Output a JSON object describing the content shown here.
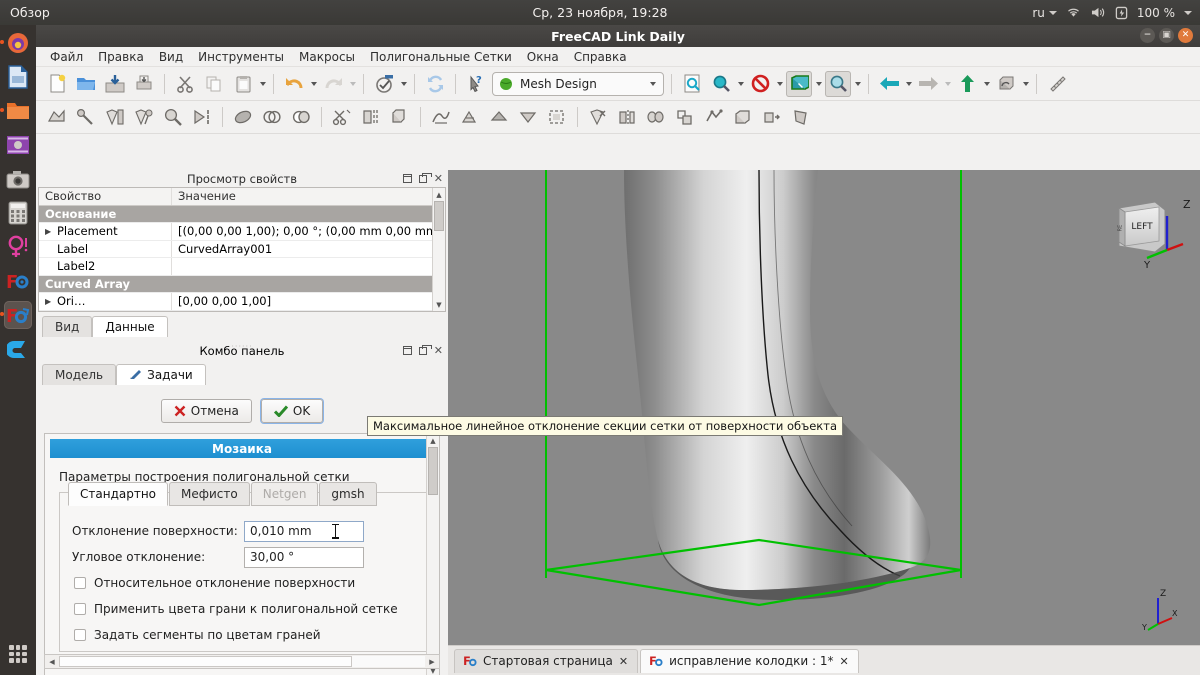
{
  "system_bar": {
    "activities": "Обзор",
    "clock": "Ср, 23 ноября, 19:28",
    "keyboard_layout": "ru",
    "battery": "100 %",
    "icons": [
      "wifi-icon",
      "volume-icon",
      "battery-icon"
    ]
  },
  "launcher": {
    "items": [
      {
        "name": "firefox",
        "label": "F",
        "color": "#e8683a",
        "running": true,
        "active": false
      },
      {
        "name": "libreoffice-writer",
        "label": "W",
        "color": "#2a6099",
        "running": false,
        "active": false
      },
      {
        "name": "files",
        "label": "▭",
        "color": "#e8702a",
        "running": true,
        "active": false
      },
      {
        "name": "video-editor",
        "label": "▶",
        "color": "#8e44ad",
        "running": false,
        "active": false
      },
      {
        "name": "camera",
        "label": "◎",
        "color": "#b9b6b2",
        "running": false,
        "active": false
      },
      {
        "name": "calculator",
        "label": "≡",
        "color": "#cfcac6",
        "running": false,
        "active": false
      },
      {
        "name": "magnifier-tool",
        "label": "Q!",
        "color": "#e040a0",
        "running": false,
        "active": false
      },
      {
        "name": "freecad",
        "label": "F",
        "color": "#cc2222",
        "running": false,
        "active": false
      },
      {
        "name": "freecad-link-daily",
        "label": "F",
        "color": "#cc2222",
        "running": true,
        "active": true
      },
      {
        "name": "clementine",
        "label": "C",
        "color": "#2aa8e8",
        "running": false,
        "active": false
      }
    ],
    "show_applications_label": "show-applications"
  },
  "window": {
    "title": "FreeCAD Link Daily",
    "controls": [
      "minimize",
      "maximize",
      "close"
    ]
  },
  "menubar": {
    "items": [
      {
        "label": "Файл",
        "mnemonic": "Ф"
      },
      {
        "label": "Правка",
        "mnemonic": "П"
      },
      {
        "label": "Вид",
        "mnemonic": "В"
      },
      {
        "label": "Инструменты",
        "mnemonic": "И"
      },
      {
        "label": "Макросы",
        "mnemonic": "М"
      },
      {
        "label": "Полигональные Сетки",
        "mnemonic": "П"
      },
      {
        "label": "Окна",
        "mnemonic": ""
      },
      {
        "label": "Справка",
        "mnemonic": "С"
      }
    ]
  },
  "toolbar": {
    "workbench_selector": {
      "value": "Mesh Design",
      "icon": "mesh-workbench-icon"
    },
    "file_group": [
      "new-document-icon",
      "open-document-icon",
      "save-document-icon",
      "print-icon"
    ],
    "edit_group": [
      "cut-icon",
      "copy-icon",
      "paste-icon",
      "undo-icon",
      "redo-icon"
    ],
    "misc_group": [
      "refresh-icon",
      "whats-this-icon",
      "std-view-fit-icon"
    ],
    "view_group": [
      "fit-all-icon",
      "zoom-icon",
      "draw-style-icon",
      "axonometric-icon",
      "zoom-box-icon",
      "back-arrow-icon",
      "forward-arrow-icon",
      "up-arrow-icon",
      "view-rotate-icon",
      "measure-icon"
    ],
    "mesh_group": [
      "mesh-from-shape-icon",
      "mesh-analyze-icon",
      "mesh-evaluate-icon",
      "mesh-repair-icon",
      "mesh-inspect-icon",
      "mesh-boundary-icon",
      "mesh-solid-icon",
      "mesh-union-icon",
      "mesh-intersect-icon",
      "mesh-cut-icon",
      "mesh-trim-icon",
      "mesh-section-icon",
      "mesh-smooth-icon",
      "mesh-decimate-icon",
      "mesh-flip-icon",
      "mesh-harmonize-icon",
      "mesh-fill-hole-icon",
      "mesh-remove-components-icon",
      "mesh-split-icon",
      "mesh-merge-icon",
      "mesh-scale-icon",
      "mesh-segment-icon",
      "mesh-build-icon",
      "mesh-export-icon",
      "mesh-polygon-icon"
    ]
  },
  "property_panel": {
    "title": "Просмотр свойств",
    "columns": [
      "Свойство",
      "Значение"
    ],
    "rows": [
      {
        "type": "group",
        "name": "Основание"
      },
      {
        "type": "item",
        "expandable": true,
        "name": "Placement",
        "value": "[(0,00 0,00 1,00); 0,00 °; (0,00 mm  0,00 mm…"
      },
      {
        "type": "item",
        "expandable": false,
        "name": "Label",
        "value": "CurvedArray001"
      },
      {
        "type": "item",
        "expandable": false,
        "name": "Label2",
        "value": ""
      },
      {
        "type": "group",
        "name": "Curved Array"
      },
      {
        "type": "item",
        "expandable": true,
        "name": "Ori…",
        "value": "[0,00 0,00 1,00]"
      }
    ],
    "tabs": [
      {
        "label": "Вид",
        "selected": false
      },
      {
        "label": "Данные",
        "selected": true
      }
    ],
    "header_buttons": [
      "restore-icon",
      "float-icon",
      "close-icon"
    ]
  },
  "combo_panel": {
    "title": "Комбо панель",
    "header_buttons": [
      "restore-icon",
      "float-icon",
      "close-icon"
    ],
    "tabs": [
      {
        "label": "Модель",
        "selected": false,
        "icon": ""
      },
      {
        "label": "Задачи",
        "selected": true,
        "icon": "tasks-icon"
      }
    ]
  },
  "task_dialog": {
    "cancel_button": {
      "label": "Отмена",
      "mnemonic": "м",
      "icon": "cancel-x-icon"
    },
    "ok_button": {
      "label": "OK",
      "mnemonic": "O",
      "icon": "ok-check-icon"
    },
    "section_title": "Мозаика",
    "subtitle": "Параметры построения полигональной сетки",
    "mesher_tabs": [
      {
        "label": "Стандартно",
        "selected": true,
        "enabled": true
      },
      {
        "label": "Мефисто",
        "selected": false,
        "enabled": true
      },
      {
        "label": "Netgen",
        "selected": false,
        "enabled": false
      },
      {
        "label": "gmsh",
        "selected": false,
        "enabled": true
      }
    ],
    "fields": [
      {
        "name": "surface-deviation",
        "label": "Отклонение поверхности:",
        "value": "0,010 mm",
        "focused": true
      },
      {
        "name": "angular-deviation",
        "label": "Угловое отклонение:",
        "value": "30,00 °",
        "focused": false
      }
    ],
    "checkboxes": [
      {
        "name": "relative-surface-deviation",
        "label": "Относительное отклонение поверхности",
        "checked": false
      },
      {
        "name": "apply-face-colors",
        "label": "Применить цвета грани к полигональной сетке",
        "checked": false
      },
      {
        "name": "define-segments-by-face-colors",
        "label": "Задать сегменты по цветам граней",
        "checked": false
      }
    ],
    "tooltip": "Максимальное линейное отклонение секции сетки от поверхности объекта"
  },
  "viewport": {
    "background_color": "#898989",
    "bounding_box_color": "#00c000",
    "model_name": "shoe-last-model",
    "nav_cube_face": "LEFT",
    "nav_cube_side": "RE",
    "axis_labels": {
      "z": "Z",
      "y": "Y",
      "x": "X"
    },
    "axis_colors": {
      "x": "#d01010",
      "y": "#00c000",
      "z": "#2020d0"
    }
  },
  "document_tabs": [
    {
      "label": "Стартовая страница",
      "selected": false,
      "close": "✕",
      "icon": "freecad-doc-icon"
    },
    {
      "label": "исправление колодки : 1*",
      "selected": true,
      "close": "✕",
      "icon": "freecad-doc-icon"
    }
  ]
}
